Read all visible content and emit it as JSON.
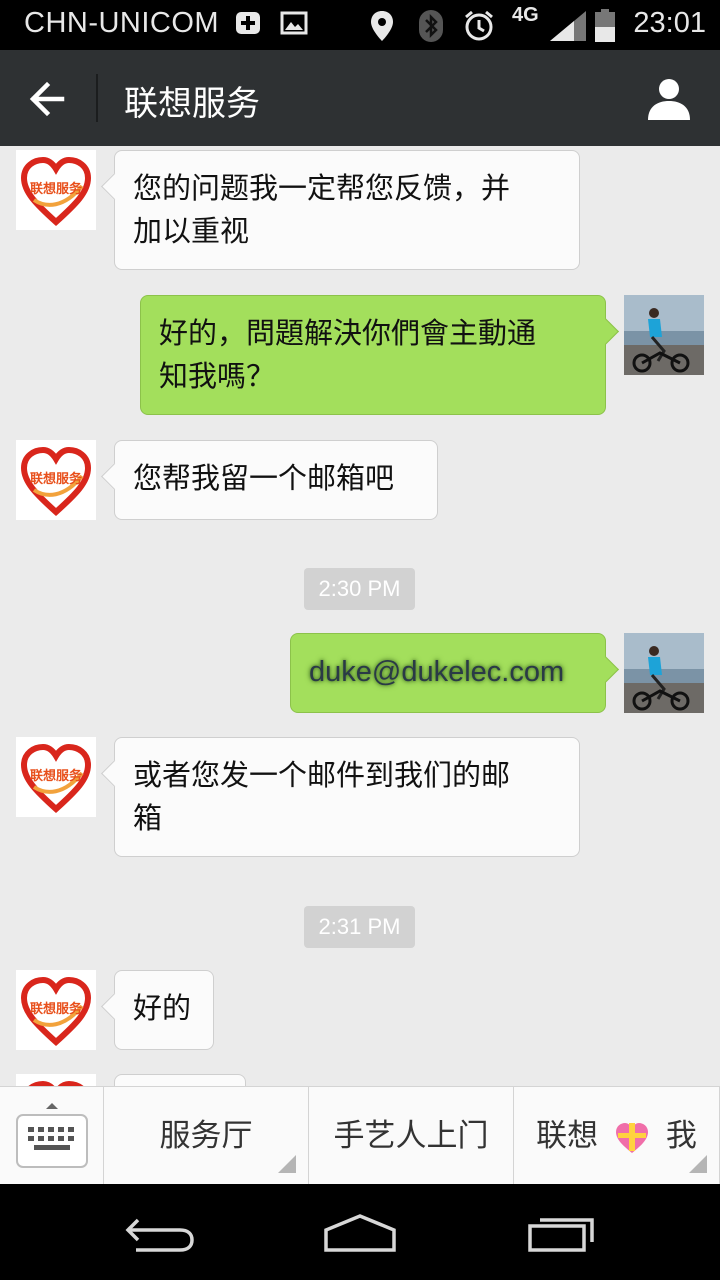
{
  "status_bar": {
    "carrier": "CHN-UNICOM",
    "network": "4G",
    "time": "23:01",
    "icons": [
      "plus-box-icon",
      "image-icon",
      "location-pin-icon",
      "bluetooth-icon",
      "alarm-icon",
      "signal-icon",
      "battery-icon"
    ]
  },
  "header": {
    "title": "联想服务",
    "back_icon": "arrow-left-icon",
    "profile_icon": "person-icon"
  },
  "messages": [
    {
      "side": "in",
      "text_line1": "您的问题我一定帮您反馈，并",
      "text_line2": "加以重视"
    },
    {
      "side": "out",
      "text_line1": "好的，問題解決你們會主動通",
      "text_line2": "知我嗎？"
    },
    {
      "side": "in",
      "text": "您帮我留一个邮箱吧"
    },
    {
      "type": "time",
      "text": "2:30 PM"
    },
    {
      "side": "out",
      "text": "duke@dukelec.com"
    },
    {
      "side": "in",
      "text_line1": "或者您发一个邮件到我们的邮",
      "text_line2": "箱"
    },
    {
      "type": "time",
      "text": "2:31 PM"
    },
    {
      "side": "in",
      "text": "好的"
    }
  ],
  "avatars": {
    "service_logo_text": "联想服务",
    "service_colors": {
      "heart": "#d9261c",
      "text": "#e8501c"
    },
    "user_colors": {
      "sky": "#a9bccb",
      "sea": "#7b93a6",
      "shirt": "#1da3d8"
    }
  },
  "menu": {
    "keyboard_icon": "keyboard-icon",
    "items": [
      {
        "label": "服务厅"
      },
      {
        "label": "手艺人上门"
      },
      {
        "label_prefix": "联想",
        "label_suffix": "我",
        "icon": "gift-heart-icon"
      }
    ]
  },
  "nav": {
    "icons": [
      "back-nav-icon",
      "home-nav-icon",
      "recents-nav-icon"
    ]
  },
  "colors": {
    "chat_bg": "#ebebeb",
    "out_bubble": "#a3df5c",
    "in_bubble": "#fbfbfb",
    "title_bar": "#2e3133"
  }
}
